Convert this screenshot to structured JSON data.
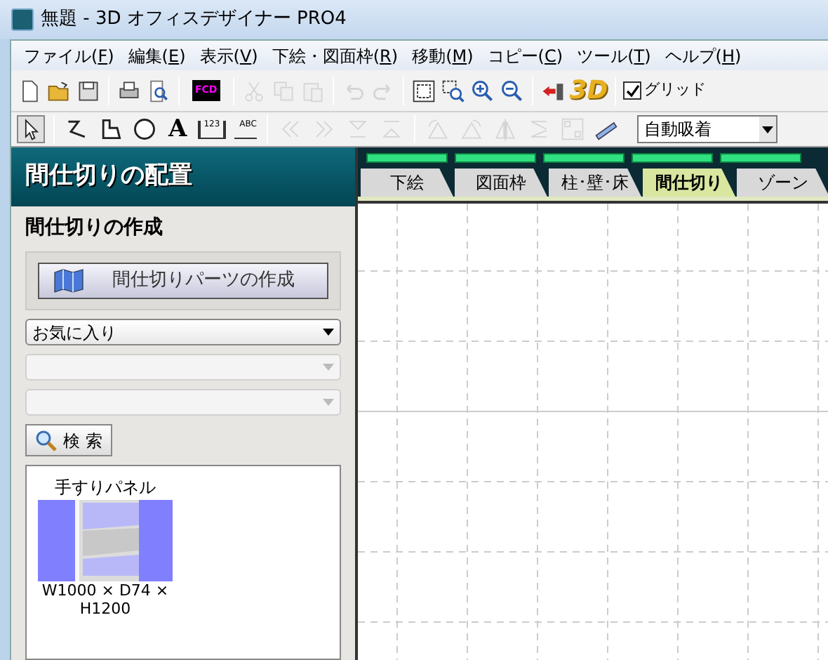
{
  "window": {
    "title": "無題 - 3D オフィスデザイナー PRO4"
  },
  "menu": [
    "ファイル(F)",
    "編集(E)",
    "表示(V)",
    "下絵・図面枠(R)",
    "移動(M)",
    "コピー(C)",
    "ツール(T)",
    "ヘルプ(H)"
  ],
  "toolbar": [
    {
      "kind": "new",
      "disabled": false
    },
    {
      "kind": "open",
      "disabled": false
    },
    {
      "kind": "save",
      "disabled": false
    },
    {
      "kind": "sep"
    },
    {
      "kind": "print",
      "disabled": false
    },
    {
      "kind": "preview",
      "disabled": false
    },
    {
      "kind": "sep"
    },
    {
      "kind": "fcd",
      "label": "FCD",
      "disabled": false
    },
    {
      "kind": "sep"
    },
    {
      "kind": "cut",
      "disabled": true
    },
    {
      "kind": "copy",
      "disabled": true
    },
    {
      "kind": "paste",
      "disabled": true
    },
    {
      "kind": "sep"
    },
    {
      "kind": "undo",
      "disabled": true
    },
    {
      "kind": "redo",
      "disabled": true
    },
    {
      "kind": "sep"
    },
    {
      "kind": "fit",
      "disabled": false
    },
    {
      "kind": "zoomarea",
      "disabled": false
    },
    {
      "kind": "zoomin",
      "disabled": false
    },
    {
      "kind": "zoomout",
      "disabled": false
    },
    {
      "kind": "sep"
    },
    {
      "kind": "exit",
      "disabled": false
    },
    {
      "kind": "view3d",
      "label": "3D",
      "disabled": false
    },
    {
      "kind": "sep"
    },
    {
      "kind": "check",
      "label": "グリッド",
      "checked": true
    }
  ],
  "toolbar2": [
    {
      "kind": "select",
      "pressed": true
    },
    {
      "kind": "sep"
    },
    {
      "kind": "polyline",
      "pressed": false
    },
    {
      "kind": "polygon",
      "pressed": false
    },
    {
      "kind": "circle",
      "pressed": false
    },
    {
      "kind": "text",
      "label": "A",
      "pressed": false
    },
    {
      "kind": "dim",
      "label": "123",
      "pressed": false
    },
    {
      "kind": "leader",
      "label": "ABC",
      "pressed": false
    },
    {
      "kind": "sep"
    },
    {
      "kind": "first",
      "disabled": true
    },
    {
      "kind": "last",
      "disabled": true
    },
    {
      "kind": "down",
      "disabled": true
    },
    {
      "kind": "up",
      "disabled": true
    },
    {
      "kind": "sep"
    },
    {
      "kind": "rotl",
      "disabled": true
    },
    {
      "kind": "rotr",
      "disabled": true
    },
    {
      "kind": "mirror",
      "disabled": true
    },
    {
      "kind": "flip",
      "disabled": true
    },
    {
      "kind": "array",
      "disabled": true
    },
    {
      "kind": "ruler",
      "disabled": false
    },
    {
      "kind": "combo",
      "value": "自動吸着"
    }
  ],
  "panel": {
    "title": "間仕切りの配置",
    "section": "間仕切りの作成",
    "create_button": "間仕切りパーツの作成",
    "selects": [
      {
        "value": "お気に入り",
        "disabled": false
      },
      {
        "disabled": true
      },
      {
        "disabled": true
      }
    ],
    "search_button": "検 索",
    "items": [
      {
        "name": "手すりパネル",
        "size": "W1000 × D74 × H1200",
        "kind": "picture"
      }
    ]
  },
  "tabs": [
    {
      "label": "下絵",
      "selected": false
    },
    {
      "label": "図面枠",
      "selected": false
    },
    {
      "label": "柱･壁･床",
      "selected": false
    },
    {
      "label": "間仕切り",
      "selected": true
    },
    {
      "label": "ゾーン",
      "selected": false
    }
  ]
}
